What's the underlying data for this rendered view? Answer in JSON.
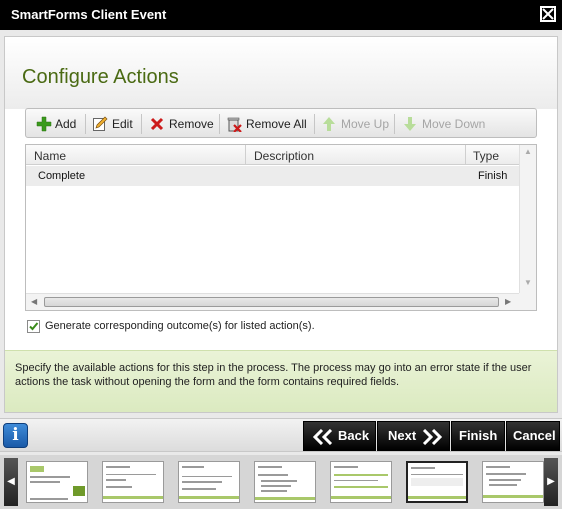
{
  "window": {
    "title": "SmartForms Client Event",
    "close_icon": "close-icon"
  },
  "page": {
    "title": "Configure Actions"
  },
  "toolbar": {
    "add_label": "Add",
    "edit_label": "Edit",
    "remove_label": "Remove",
    "remove_all_label": "Remove All",
    "move_up_label": "Move Up",
    "move_down_label": "Move Down"
  },
  "grid": {
    "columns": [
      "Name",
      "Description",
      "Type"
    ],
    "rows": [
      {
        "name": "Complete",
        "description": "",
        "type": "Finish"
      }
    ]
  },
  "options": {
    "generate_outcomes_label": "Generate corresponding outcome(s) for listed action(s).",
    "generate_outcomes_checked": true
  },
  "info": {
    "text": "Specify the available actions for this step in the process. The process may go into an error state if the user actions the task without opening the form and the form contains required fields."
  },
  "nav": {
    "info_glyph": "i",
    "back_label": "Back",
    "next_label": "Next",
    "finish_label": "Finish",
    "cancel_label": "Cancel"
  },
  "thumbnails": {
    "count": 7,
    "active_index": 5
  },
  "colors": {
    "title_green": "#4a6a13",
    "info_band": "#e3efcb",
    "button_black": "#000000",
    "info_blue": "#1a5aa8",
    "add_green": "#3a9a1c",
    "remove_red": "#cc1a1a"
  }
}
